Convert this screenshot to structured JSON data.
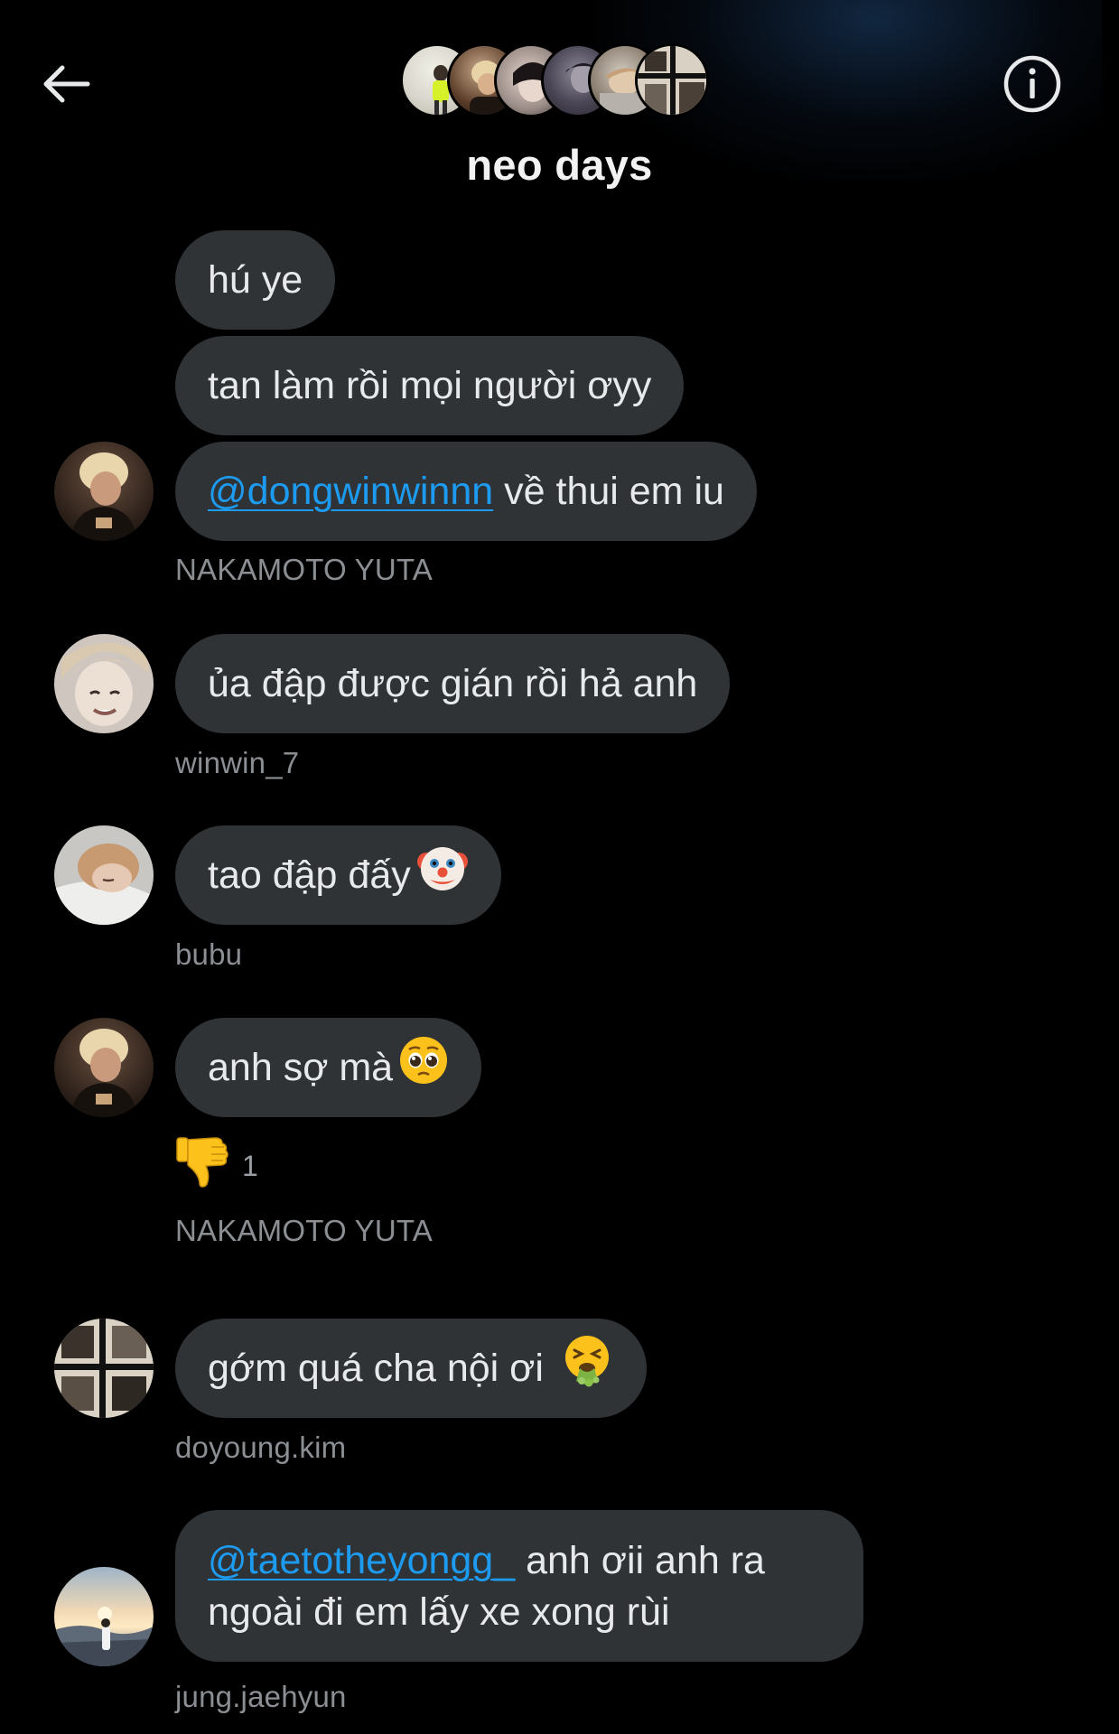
{
  "header": {
    "title": "neo days",
    "back_icon": "arrow-left-icon",
    "info_icon": "info-icon"
  },
  "colors": {
    "background": "#000000",
    "bubble": "#2f3336",
    "mention": "#1d9bf0",
    "secondary_text": "#8b8f94"
  },
  "messages": [
    {
      "text": "hú ye"
    },
    {
      "text": "tan làm rồi mọi người ơyy"
    },
    {
      "mention": "@dongwinwinnn",
      "text": " về thui em iu",
      "sender": "NAKAMOTO YUTA"
    },
    {
      "text": "ủa đập được gián rồi hả anh",
      "sender": "winwin_7"
    },
    {
      "text": "tao đập đấy",
      "emoji": "clown-face-icon",
      "sender": "bubu"
    },
    {
      "text": "anh sợ mà",
      "emoji": "pleading-face-icon",
      "sender": "NAKAMOTO YUTA",
      "reaction": {
        "icon": "thumbs-down-icon",
        "count": "1"
      }
    },
    {
      "text": "gớm quá cha nội ơi ",
      "emoji": "vomiting-face-icon",
      "sender": "doyoung.kim"
    },
    {
      "mention": "@taetotheyongg_",
      "text": " anh ơii anh ra ngoài đi em lấy xe xong rùi",
      "sender": "jung.jaehyun"
    }
  ]
}
